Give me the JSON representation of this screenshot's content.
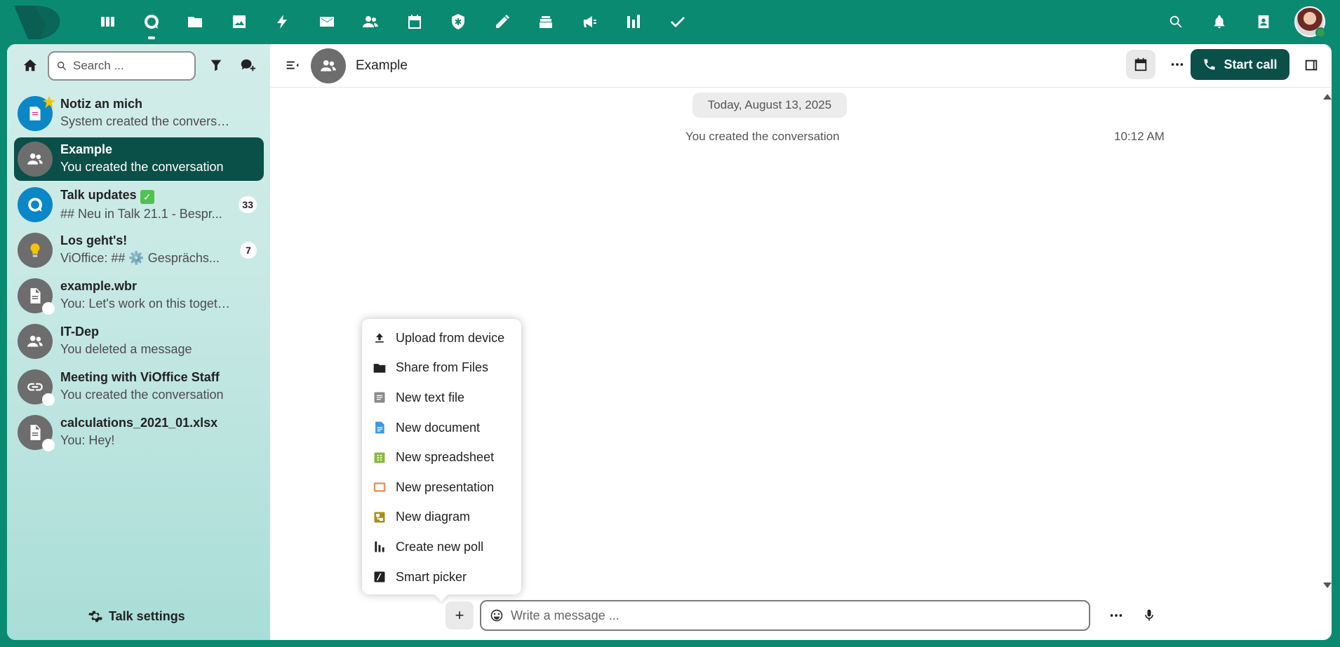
{
  "topbar": {
    "apps": [
      {
        "icon": "dashboard-icon",
        "label": "Dashboard"
      },
      {
        "icon": "talk-icon",
        "label": "Talk"
      },
      {
        "icon": "files-icon",
        "label": "Files"
      },
      {
        "icon": "photos-icon",
        "label": "Photos"
      },
      {
        "icon": "activity-icon",
        "label": "Activity"
      },
      {
        "icon": "mail-icon",
        "label": "Mail"
      },
      {
        "icon": "contacts-icon",
        "label": "Contacts"
      },
      {
        "icon": "calendar-icon",
        "label": "Calendar"
      },
      {
        "icon": "passwords-icon",
        "label": "Passwords"
      },
      {
        "icon": "notes-icon",
        "label": "Notes"
      },
      {
        "icon": "deck-icon",
        "label": "Deck"
      },
      {
        "icon": "announcements-icon",
        "label": "Announcements"
      },
      {
        "icon": "analytics-icon",
        "label": "Analytics"
      },
      {
        "icon": "tasks-icon",
        "label": "Tasks"
      }
    ],
    "active_app": "Talk",
    "right_icons": [
      "search-icon",
      "notifications-icon",
      "contacts-menu-icon"
    ]
  },
  "sidebar": {
    "search_placeholder": "Search ...",
    "conversations": [
      {
        "name": "Notiz an mich",
        "sub": "System created the conversation",
        "badge": ""
      },
      {
        "name": "Example",
        "sub": "You created the conversation",
        "badge": ""
      },
      {
        "name": "Talk updates",
        "sub": "## Neu in Talk 21.1 - Bespr...",
        "badge": "33"
      },
      {
        "name": "Los geht's!",
        "sub": "ViOffice: ## ⚙️ Gesprächs...",
        "badge": "7"
      },
      {
        "name": "example.wbr",
        "sub": "You: Let's work on this together!",
        "badge": ""
      },
      {
        "name": "IT-Dep",
        "sub": "You deleted a message",
        "badge": ""
      },
      {
        "name": "Meeting with ViOffice Staff",
        "sub": "You created the conversation",
        "badge": ""
      },
      {
        "name": "calculations_2021_01.xlsx",
        "sub": "You: Hey!",
        "badge": ""
      }
    ],
    "settings_label": "Talk settings"
  },
  "header": {
    "title": "Example",
    "start_call_label": "Start call"
  },
  "chat": {
    "date_separator": "Today, August 13, 2025",
    "system_message": "You created the conversation",
    "system_time": "10:12 AM"
  },
  "attach_menu": {
    "items": [
      {
        "label": "Upload from device",
        "icon": "upload-icon"
      },
      {
        "label": "Share from Files",
        "icon": "folder-icon"
      },
      {
        "label": "New text file",
        "icon": "text-file-icon"
      },
      {
        "label": "New document",
        "icon": "document-icon"
      },
      {
        "label": "New spreadsheet",
        "icon": "spreadsheet-icon"
      },
      {
        "label": "New presentation",
        "icon": "presentation-icon"
      },
      {
        "label": "New diagram",
        "icon": "diagram-icon"
      },
      {
        "label": "Create new poll",
        "icon": "poll-icon"
      },
      {
        "label": "Smart picker",
        "icon": "smart-picker-icon"
      }
    ]
  },
  "composer": {
    "plus_label": "+",
    "placeholder": "Write a message ..."
  },
  "colors": {
    "brand": "#0b8a72",
    "active_conversation": "#0b4f49",
    "start_call": "#0b4f49"
  }
}
